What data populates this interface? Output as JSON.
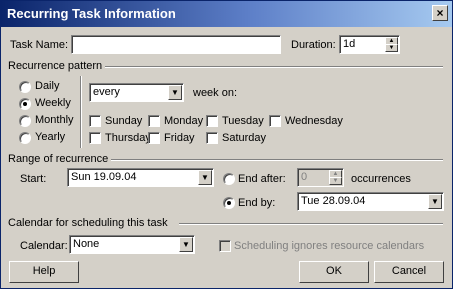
{
  "window": {
    "title": "Recurring Task Information",
    "close_glyph": "×"
  },
  "task": {
    "name_label": "Task Name:",
    "name_value": "",
    "duration_label": "Duration:",
    "duration_value": "1d"
  },
  "recurrence": {
    "group_label": "Recurrence pattern",
    "options": [
      "Daily",
      "Weekly",
      "Monthly",
      "Yearly"
    ],
    "selected": "Weekly",
    "every_value": "every",
    "week_on_label": "week on:",
    "days": [
      "Sunday",
      "Monday",
      "Tuesday",
      "Wednesday",
      "Thursday",
      "Friday",
      "Saturday"
    ]
  },
  "range": {
    "group_label": "Range of recurrence",
    "start_label": "Start:",
    "start_value": "Sun 19.09.04",
    "end_after_label": "End after:",
    "occurrences_value": "0",
    "occurrences_label": "occurrences",
    "end_by_label": "End by:",
    "end_by_value": "Tue 28.09.04",
    "selected_end": "End by"
  },
  "calendar": {
    "group_label": "Calendar for scheduling this task",
    "calendar_label": "Calendar:",
    "calendar_value": "None",
    "ignore_label": "Scheduling ignores resource calendars"
  },
  "buttons": {
    "help": "Help",
    "ok": "OK",
    "cancel": "Cancel"
  }
}
